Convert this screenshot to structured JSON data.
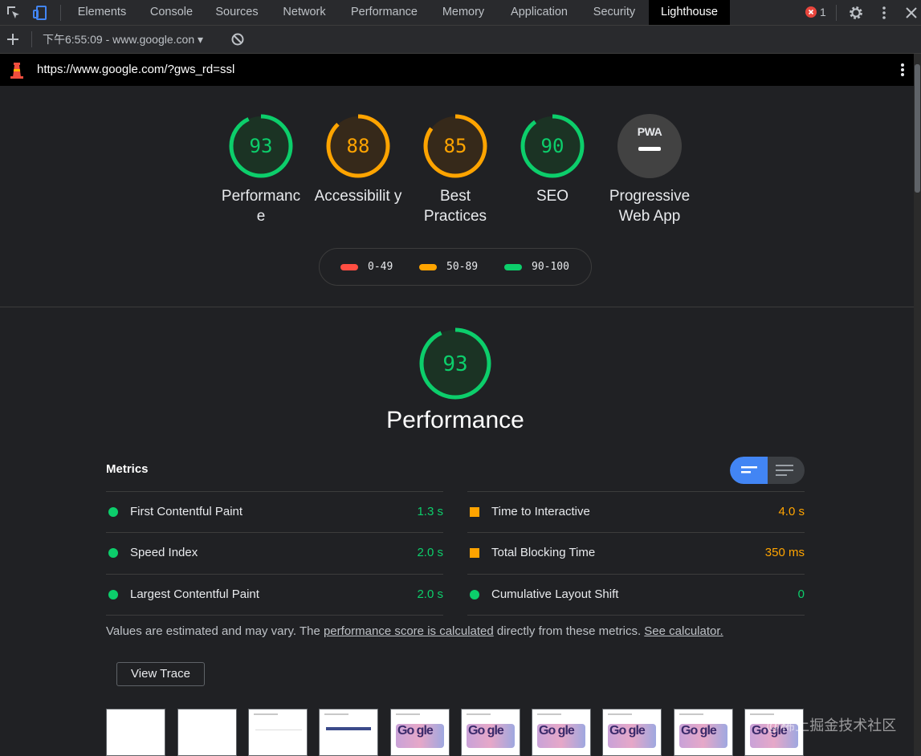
{
  "devtools": {
    "tabs": [
      "Elements",
      "Console",
      "Sources",
      "Network",
      "Performance",
      "Memory",
      "Application",
      "Security",
      "Lighthouse"
    ],
    "active_tab": "Lighthouse",
    "error_count": "1"
  },
  "toolbar": {
    "report_select": "下午6:55:09 - www.google.con ▾"
  },
  "urlbar": {
    "url": "https://www.google.com/?gws_rd=ssl"
  },
  "summary": {
    "categories": [
      {
        "score": "93",
        "label": "Performanc e",
        "status": "pass"
      },
      {
        "score": "88",
        "label": "Accessibilit y",
        "status": "average"
      },
      {
        "score": "85",
        "label": "Best Practices",
        "status": "average"
      },
      {
        "score": "90",
        "label": "SEO",
        "status": "pass"
      },
      {
        "score": "",
        "label": "Progressive Web App",
        "status": "pwa",
        "badge": "PWA"
      }
    ],
    "legend": [
      {
        "range": "0-49",
        "color": "#ff4e42"
      },
      {
        "range": "50-89",
        "color": "#ffa400"
      },
      {
        "range": "90-100",
        "color": "#0cce6b"
      }
    ]
  },
  "performance": {
    "score": "93",
    "title": "Performance",
    "metrics_title": "Metrics",
    "metrics": [
      {
        "label": "First Contentful Paint",
        "value": "1.3 s",
        "status": "pass"
      },
      {
        "label": "Time to Interactive",
        "value": "4.0 s",
        "status": "average"
      },
      {
        "label": "Speed Index",
        "value": "2.0 s",
        "status": "pass"
      },
      {
        "label": "Total Blocking Time",
        "value": "350 ms",
        "status": "average"
      },
      {
        "label": "Largest Contentful Paint",
        "value": "2.0 s",
        "status": "pass"
      },
      {
        "label": "Cumulative Layout Shift",
        "value": "0",
        "status": "pass"
      }
    ],
    "note_prefix": "Values are estimated and may vary. The ",
    "note_link1": "performance score is calculated",
    "note_middle": " directly from these metrics. ",
    "note_link2": "See calculator.",
    "view_trace": "View Trace",
    "doodle_text": "Go gle"
  },
  "colors": {
    "pass": "#0cce6b",
    "average": "#ffa400",
    "fail": "#ff4e42"
  },
  "watermark": "@稀土掘金技术社区"
}
